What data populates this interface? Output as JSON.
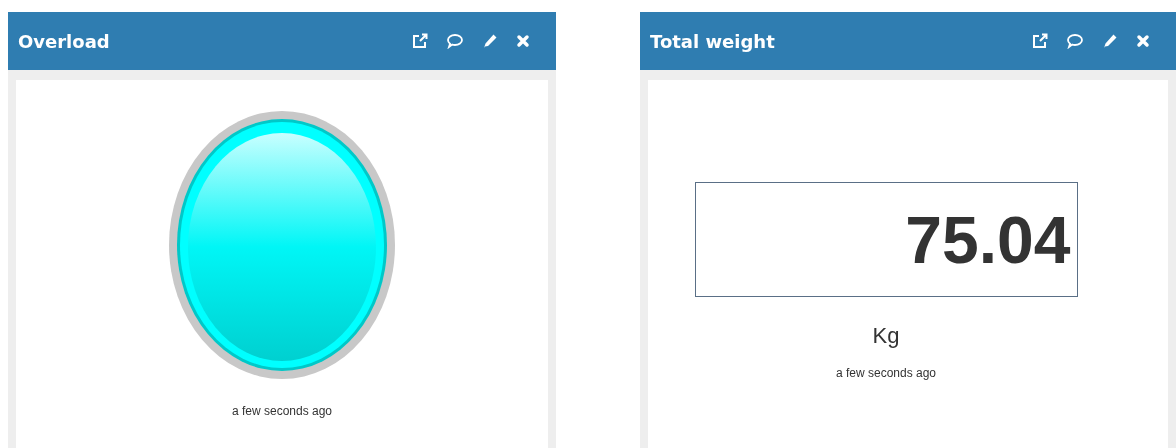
{
  "widgets": [
    {
      "kind": "led",
      "title": "Overload",
      "lit": true,
      "updated": "a few seconds ago"
    },
    {
      "kind": "value",
      "title": "Total weight",
      "value": "75.04",
      "unit": "Kg",
      "updated": "a few seconds ago"
    }
  ]
}
